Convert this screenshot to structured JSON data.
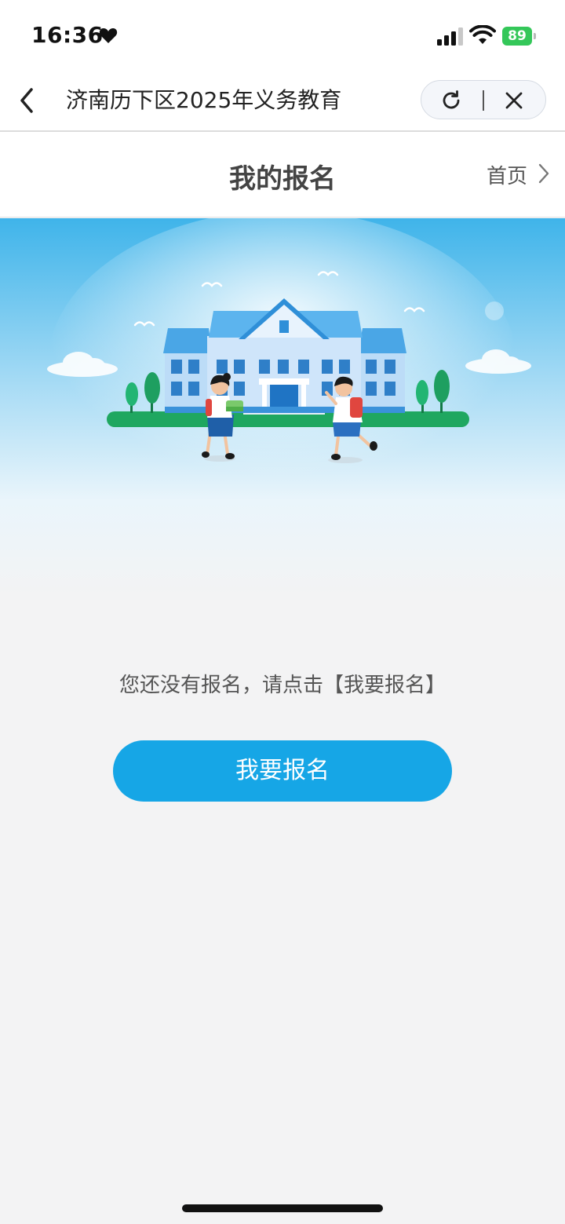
{
  "status_bar": {
    "time": "16:36",
    "battery": "89",
    "accent": "#34c759"
  },
  "navbar": {
    "title": "济南历下区2025年义务教育"
  },
  "header": {
    "title": "我的报名",
    "home_link": "首页"
  },
  "empty_state": {
    "hint": "您还没有报名，请点击【我要报名】",
    "button_label": "我要报名"
  },
  "colors": {
    "primary": "#16a6e6",
    "background": "#f3f3f4"
  }
}
